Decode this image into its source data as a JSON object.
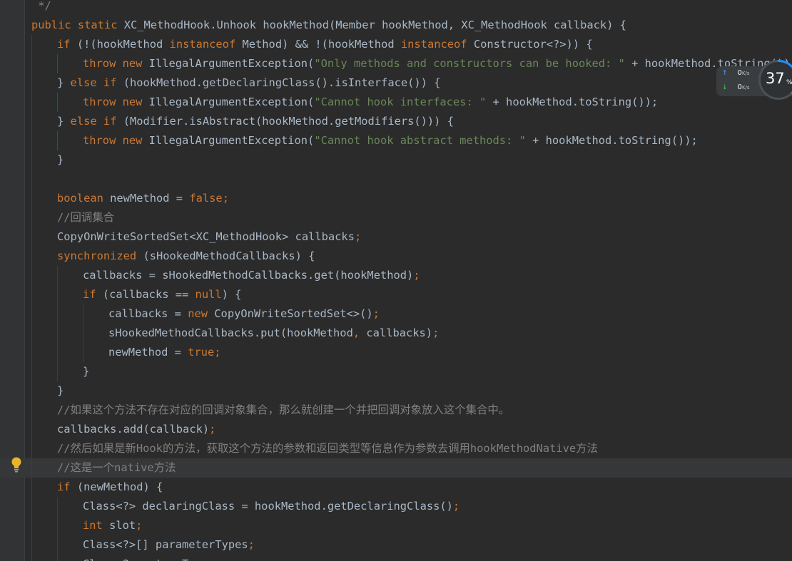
{
  "editor": {
    "lines": [
      [
        {
          "ind": 0
        },
        {
          "t": "c",
          "v": " */"
        }
      ],
      [
        {
          "t": "k",
          "v": "public static "
        },
        {
          "t": "n",
          "v": "XC_MethodHook.Unhook hookMethod(Member hookMethod, XC_MethodHook callback) {"
        }
      ],
      [
        {
          "ind": 1
        },
        {
          "t": "k",
          "v": "if "
        },
        {
          "t": "n",
          "v": "(!(hookMethod "
        },
        {
          "t": "k",
          "v": "instanceof "
        },
        {
          "t": "n",
          "v": "Method) && !(hookMethod "
        },
        {
          "t": "k",
          "v": "instanceof "
        },
        {
          "t": "n",
          "v": "Constructor<?>)) {"
        }
      ],
      [
        {
          "ind": 2,
          "red": true
        },
        {
          "t": "k",
          "v": "throw new "
        },
        {
          "t": "n",
          "v": "IllegalArgumentException("
        },
        {
          "t": "s",
          "v": "\"Only methods and constructors can be hooked: \""
        },
        {
          "t": "n",
          "v": " + hookMethod.toString());"
        }
      ],
      [
        {
          "ind": 1
        },
        {
          "t": "n",
          "v": "} "
        },
        {
          "t": "k",
          "v": "else if "
        },
        {
          "t": "n",
          "v": "(hookMethod.getDeclaringClass().isInterface()) {"
        }
      ],
      [
        {
          "ind": 2,
          "red": true
        },
        {
          "t": "k",
          "v": "throw new "
        },
        {
          "t": "n",
          "v": "IllegalArgumentException("
        },
        {
          "t": "s",
          "v": "\"Cannot hook interfaces: \""
        },
        {
          "t": "n",
          "v": " + hookMethod.toString());"
        }
      ],
      [
        {
          "ind": 1
        },
        {
          "t": "n",
          "v": "} "
        },
        {
          "t": "k",
          "v": "else if "
        },
        {
          "t": "n",
          "v": "(Modifier.isAbstract(hookMethod.getModifiers())) {"
        }
      ],
      [
        {
          "ind": 2,
          "red": true
        },
        {
          "t": "k",
          "v": "throw new "
        },
        {
          "t": "n",
          "v": "IllegalArgumentException("
        },
        {
          "t": "s",
          "v": "\"Cannot hook abstract methods: \""
        },
        {
          "t": "n",
          "v": " + hookMethod.toString());"
        }
      ],
      [
        {
          "ind": 1
        },
        {
          "t": "n",
          "v": "}"
        }
      ],
      [
        {
          "ind": 1
        }
      ],
      [
        {
          "ind": 1
        },
        {
          "t": "k",
          "v": "boolean "
        },
        {
          "t": "n",
          "v": "newMethod = "
        },
        {
          "t": "k",
          "v": "false"
        },
        {
          "t": "k",
          "v": ";"
        }
      ],
      [
        {
          "ind": 1
        },
        {
          "t": "c",
          "v": "//回调集合"
        }
      ],
      [
        {
          "ind": 1
        },
        {
          "t": "n",
          "v": "CopyOnWriteSortedSet<XC_MethodHook> callbacks"
        },
        {
          "t": "k",
          "v": ";"
        }
      ],
      [
        {
          "ind": 1
        },
        {
          "t": "k",
          "v": "synchronized "
        },
        {
          "t": "n",
          "v": "(sHookedMethodCallbacks) {"
        }
      ],
      [
        {
          "ind": 2
        },
        {
          "t": "n",
          "v": "callbacks = sHookedMethodCallbacks.get(hookMethod)"
        },
        {
          "t": "k",
          "v": ";"
        }
      ],
      [
        {
          "ind": 2
        },
        {
          "t": "k",
          "v": "if "
        },
        {
          "t": "n",
          "v": "(callbacks == "
        },
        {
          "t": "k",
          "v": "null"
        },
        {
          "t": "n",
          "v": ") {"
        }
      ],
      [
        {
          "ind": 3
        },
        {
          "t": "n",
          "v": "callbacks = "
        },
        {
          "t": "k",
          "v": "new "
        },
        {
          "t": "n",
          "v": "CopyOnWriteSortedSet<>()"
        },
        {
          "t": "k",
          "v": ";"
        }
      ],
      [
        {
          "ind": 3
        },
        {
          "t": "n",
          "v": "sHookedMethodCallbacks.put(hookMethod"
        },
        {
          "t": "k",
          "v": ", "
        },
        {
          "t": "n",
          "v": "callbacks)"
        },
        {
          "t": "k",
          "v": ";"
        }
      ],
      [
        {
          "ind": 3
        },
        {
          "t": "n",
          "v": "newMethod = "
        },
        {
          "t": "k",
          "v": "true"
        },
        {
          "t": "k",
          "v": ";"
        }
      ],
      [
        {
          "ind": 2
        },
        {
          "t": "n",
          "v": "}"
        }
      ],
      [
        {
          "ind": 1
        },
        {
          "t": "n",
          "v": "}"
        }
      ],
      [
        {
          "ind": 1
        },
        {
          "t": "c",
          "v": "//如果这个方法不存在对应的回调对象集合，那么就创建一个并把回调对象放入这个集合中。"
        }
      ],
      [
        {
          "ind": 1
        },
        {
          "t": "n",
          "v": "callbacks.add(callback)"
        },
        {
          "t": "k",
          "v": ";"
        }
      ],
      [
        {
          "ind": 1
        },
        {
          "t": "c",
          "v": "//然后如果是新Hook的方法，获取这个方法的参数和返回类型等信息作为参数去调用hookMethodNative方法"
        }
      ],
      [
        {
          "ind": 1,
          "hl": true
        },
        {
          "t": "c",
          "v": "//这是一个native方法"
        }
      ],
      [
        {
          "ind": 1
        },
        {
          "t": "k",
          "v": "if "
        },
        {
          "t": "n",
          "v": "(newMethod) {"
        }
      ],
      [
        {
          "ind": 2
        },
        {
          "t": "n",
          "v": "Class<?> declaringClass = hookMethod.getDeclaringClass()"
        },
        {
          "t": "k",
          "v": ";"
        }
      ],
      [
        {
          "ind": 2
        },
        {
          "t": "k",
          "v": "int "
        },
        {
          "t": "n",
          "v": "slot"
        },
        {
          "t": "k",
          "v": ";"
        }
      ],
      [
        {
          "ind": 2
        },
        {
          "t": "n",
          "v": "Class<?>[] parameterTypes"
        },
        {
          "t": "k",
          "v": ";"
        }
      ],
      [
        {
          "ind": 2
        },
        {
          "t": "n",
          "v": "Class<?> returnType"
        },
        {
          "t": "k",
          "v": ";"
        }
      ]
    ]
  },
  "colors": {
    "background": "#2b2b2b",
    "keyword": "#cc7832",
    "string": "#6a8759",
    "comment": "#808080",
    "plain": "#a9b7c6"
  },
  "net_monitor": {
    "upload_value": "0",
    "upload_unit": "K/s",
    "download_value": "0",
    "download_unit": "K/s",
    "upload_icon": "arrow-up-icon",
    "download_icon": "arrow-down-icon"
  },
  "usage": {
    "value": "37",
    "unit": "%",
    "fraction": 0.37
  },
  "gutter": {
    "intention_icon": "lightbulb-icon"
  }
}
